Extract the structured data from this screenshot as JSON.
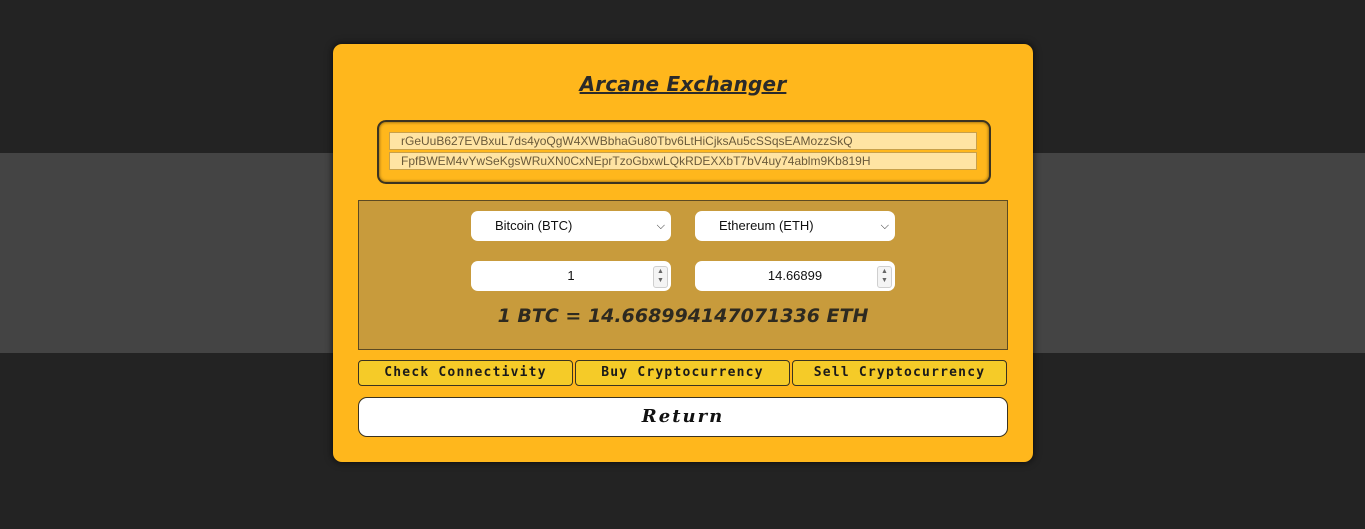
{
  "app": {
    "title": "Arcane Exchanger"
  },
  "keys": {
    "public_key": "rGeUuB627EVBxuL7ds4yoQgW4XWBbhaGu80Tbv6LtHiCjksAu5cSSqsEAMozzSkQ",
    "private_key": "FpfBWEM4vYwSeKgsWRuXN0CxNEprTzoGbxwLQkRDEXXbT7bV4uy74ablm9Kb819H"
  },
  "exchange": {
    "from_currency": "Bitcoin (BTC)",
    "to_currency": "Ethereum (ETH)",
    "from_amount": "1",
    "to_amount": "14.66899",
    "rate_text": "1 BTC = 14.668994147071336 ETH",
    "dropdown_icon": "chevron-down-icon",
    "spinner_icon": "spinner-arrows-icon"
  },
  "actions": {
    "check_connectivity": "Check Connectivity",
    "buy": "Buy Cryptocurrency",
    "sell": "Sell Cryptocurrency",
    "return": "Return"
  },
  "colors": {
    "page_background": "#232323",
    "band": "#444444",
    "panel": "#ffb71c",
    "exchange_box": "#c89b3c",
    "action_button": "#f5cb28",
    "return_button": "#ffffff"
  }
}
